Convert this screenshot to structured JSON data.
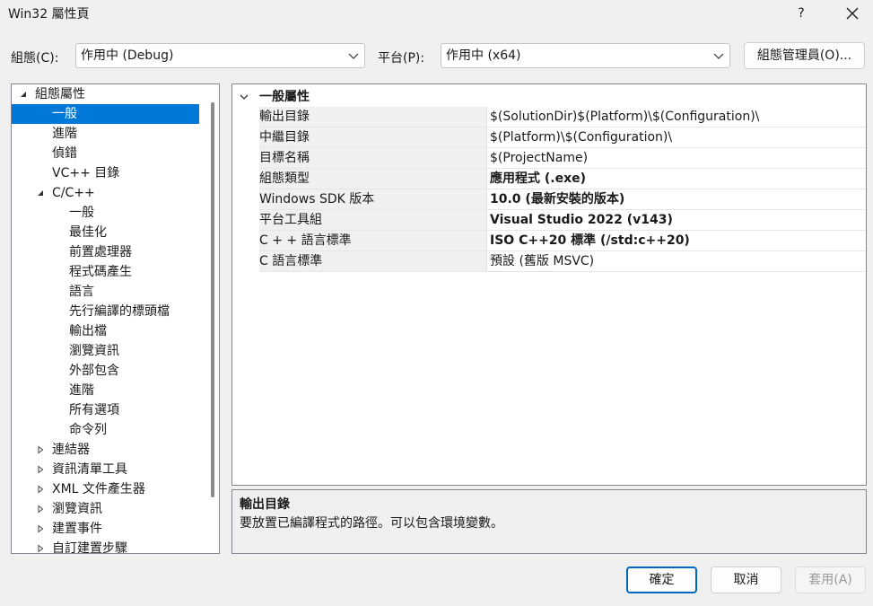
{
  "window": {
    "title": "Win32 屬性頁",
    "help_label": "?"
  },
  "config_bar": {
    "configuration_label": "組態(C):",
    "configuration_value": "作用中 (Debug)",
    "platform_label": "平台(P):",
    "platform_value": "作用中 (x64)",
    "config_manager_label": "組態管理員(O)..."
  },
  "tree": {
    "items": [
      {
        "label": "組態屬性",
        "level": 0,
        "expander": "expanded"
      },
      {
        "label": "一般",
        "level": 1,
        "expander": "none",
        "selected": true
      },
      {
        "label": "進階",
        "level": 1,
        "expander": "none"
      },
      {
        "label": "偵錯",
        "level": 1,
        "expander": "none"
      },
      {
        "label": "VC++ 目錄",
        "level": 1,
        "expander": "none"
      },
      {
        "label": "C/C++",
        "level": 1,
        "expander": "expanded"
      },
      {
        "label": "一般",
        "level": 2,
        "expander": "none"
      },
      {
        "label": "最佳化",
        "level": 2,
        "expander": "none"
      },
      {
        "label": "前置處理器",
        "level": 2,
        "expander": "none"
      },
      {
        "label": "程式碼產生",
        "level": 2,
        "expander": "none"
      },
      {
        "label": "語言",
        "level": 2,
        "expander": "none"
      },
      {
        "label": "先行編譯的標頭檔",
        "level": 2,
        "expander": "none"
      },
      {
        "label": "輸出檔",
        "level": 2,
        "expander": "none"
      },
      {
        "label": "瀏覽資訊",
        "level": 2,
        "expander": "none"
      },
      {
        "label": "外部包含",
        "level": 2,
        "expander": "none"
      },
      {
        "label": "進階",
        "level": 2,
        "expander": "none"
      },
      {
        "label": "所有選項",
        "level": 2,
        "expander": "none"
      },
      {
        "label": "命令列",
        "level": 2,
        "expander": "none"
      },
      {
        "label": "連結器",
        "level": 1,
        "expander": "collapsed"
      },
      {
        "label": "資訊清單工具",
        "level": 1,
        "expander": "collapsed"
      },
      {
        "label": "XML 文件產生器",
        "level": 1,
        "expander": "collapsed"
      },
      {
        "label": "瀏覽資訊",
        "level": 1,
        "expander": "collapsed"
      },
      {
        "label": "建置事件",
        "level": 1,
        "expander": "collapsed"
      },
      {
        "label": "自訂建置步驟",
        "level": 1,
        "expander": "collapsed"
      }
    ]
  },
  "grid": {
    "category": "一般屬性",
    "rows": [
      {
        "name": "輸出目錄",
        "value": "$(SolutionDir)$(Platform)\\$(Configuration)\\",
        "bold": false
      },
      {
        "name": "中繼目錄",
        "value": "$(Platform)\\$(Configuration)\\",
        "bold": false
      },
      {
        "name": "目標名稱",
        "value": "$(ProjectName)",
        "bold": false
      },
      {
        "name": "組態類型",
        "value": "應用程式 (.exe)",
        "bold": true
      },
      {
        "name": "Windows SDK 版本",
        "value": "10.0 (最新安裝的版本)",
        "bold": true
      },
      {
        "name": "平台工具組",
        "value": "Visual Studio 2022 (v143)",
        "bold": true
      },
      {
        "name": "C + + 語言標準",
        "value": "ISO C++20 標準 (/std:c++20)",
        "bold": true
      },
      {
        "name": "C 語言標準",
        "value": "預設 (舊版 MSVC)",
        "bold": false
      }
    ]
  },
  "description": {
    "title": "輸出目錄",
    "text": "要放置已編譯程式的路徑。可以包含環境變數。"
  },
  "footer": {
    "ok_label": "確定",
    "cancel_label": "取消",
    "apply_label": "套用(A)"
  },
  "colors": {
    "selection": "#0078d7",
    "focus_border": "#0067c0",
    "disabled_text": "#9a9a9a"
  }
}
